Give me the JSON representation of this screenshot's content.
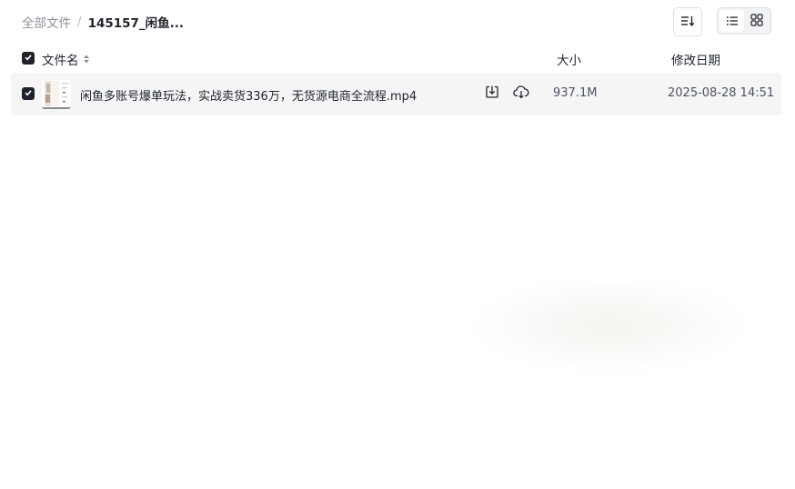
{
  "breadcrumb": {
    "root": "全部文件",
    "separator": "/",
    "current": "145157_闲鱼..."
  },
  "toolbar": {
    "sort_icon": "sort-lines-icon",
    "view_list_icon": "list-view-icon",
    "view_grid_icon": "grid-view-icon",
    "active_view": "list"
  },
  "list": {
    "columns": {
      "name": "文件名",
      "size": "大小",
      "date": "修改日期"
    },
    "header_checked": true,
    "files": [
      {
        "name": "闲鱼多账号爆单玩法，实战卖货336万，无货源电商全流程.mp4",
        "size": "937.1M",
        "modified": "2025-08-28 14:51",
        "checked": true
      }
    ]
  },
  "colors": {
    "text": "#1f2329",
    "muted": "#8a8f99",
    "row_bg": "#f5f5f6",
    "checkbox": "#1f2329"
  }
}
